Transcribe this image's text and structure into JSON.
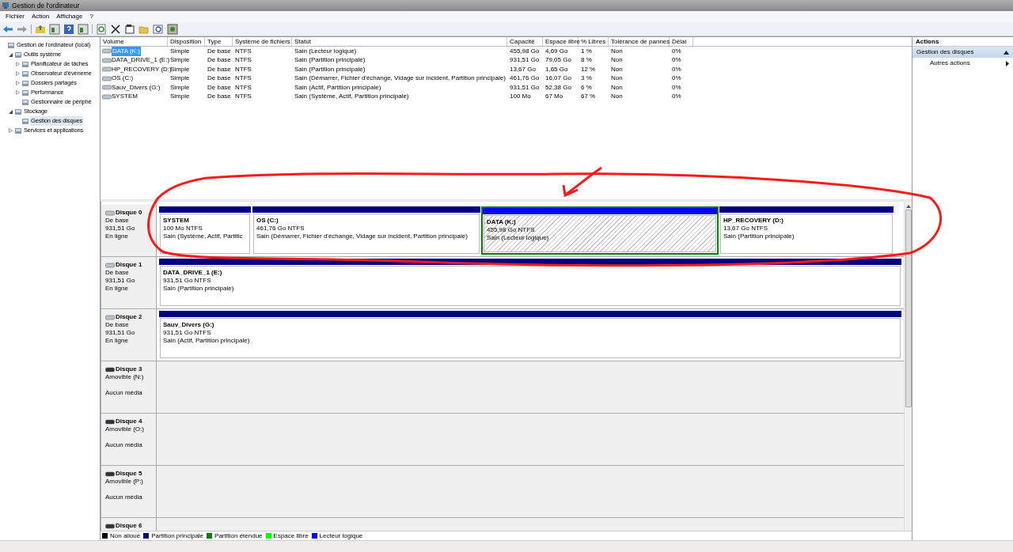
{
  "window": {
    "title": "Gestion de l'ordinateur"
  },
  "menu": [
    "Fichier",
    "Action",
    "Affichage",
    "?"
  ],
  "tree": [
    {
      "label": "Gestion de l'ordinateur (local)",
      "selected": false,
      "children": [
        {
          "label": "Outils système",
          "expanded": true,
          "selected": false,
          "children": [
            {
              "label": "Planificateur de tâches",
              "expanded": false,
              "selected": false
            },
            {
              "label": "Observateur d'événeme",
              "expanded": false,
              "selected": false
            },
            {
              "label": "Dossiers partagés",
              "expanded": false,
              "selected": false
            },
            {
              "label": "Performance",
              "expanded": false,
              "selected": false
            },
            {
              "label": "Gestionnaire de périphé",
              "selected": false
            }
          ]
        },
        {
          "label": "Stockage",
          "expanded": true,
          "selected": false,
          "children": [
            {
              "label": "Gestion des disques",
              "selected": true
            }
          ]
        },
        {
          "label": "Services et applications",
          "expanded": false,
          "selected": false
        }
      ]
    }
  ],
  "volumes": {
    "columns": [
      "Volume",
      "Disposition",
      "Type",
      "Système de fichiers",
      "Statut",
      "Capacité",
      "Espace libre",
      "% Libres",
      "Tolérance de pannes",
      "Délai"
    ],
    "rows": [
      {
        "selected": true,
        "cells": [
          "DATA (K:)",
          "Simple",
          "De base",
          "NTFS",
          "Sain (Lecteur logique)",
          "455,98 Go",
          "4,69 Go",
          "1 %",
          "Non",
          "0%"
        ]
      },
      {
        "selected": false,
        "cells": [
          "DATA_DRIVE_1 (E:)",
          "Simple",
          "De base",
          "NTFS",
          "Sain (Partition principale)",
          "931,51 Go",
          "79,05 Go",
          "8 %",
          "Non",
          "0%"
        ]
      },
      {
        "selected": false,
        "cells": [
          "HP_RECOVERY (D:)",
          "Simple",
          "De base",
          "NTFS",
          "Sain (Partition principale)",
          "13,67 Go",
          "1,65 Go",
          "12 %",
          "Non",
          "0%"
        ]
      },
      {
        "selected": false,
        "cells": [
          "OS (C:)",
          "Simple",
          "De base",
          "NTFS",
          "Sain (Démarrer, Fichier d'échange, Vidage sur incident, Partition principale)",
          "461,76 Go",
          "16,07 Go",
          "3 %",
          "Non",
          "0%"
        ]
      },
      {
        "selected": false,
        "cells": [
          "Sauv_Divers (G:)",
          "Simple",
          "De base",
          "NTFS",
          "Sain (Actif, Partition principale)",
          "931,51 Go",
          "52,38 Go",
          "6 %",
          "Non",
          "0%"
        ]
      },
      {
        "selected": false,
        "cells": [
          "SYSTEM",
          "Simple",
          "De base",
          "NTFS",
          "Sain (Système, Actif, Partition principale)",
          "100 Mo",
          "67 Mo",
          "67 %",
          "Non",
          "0%"
        ]
      }
    ]
  },
  "disks": [
    {
      "kind": "basic",
      "name": "Disque 0",
      "lines": [
        "De base",
        "931,51 Go",
        "En ligne"
      ],
      "partitions": [
        {
          "kind": "primary",
          "selected": false,
          "name": "SYSTEM",
          "size": "100 Mo NTFS",
          "status": "Sain (Système, Actif, Partitic"
        },
        {
          "kind": "primary",
          "selected": false,
          "name": "OS  (C:)",
          "size": "461,76 Go NTFS",
          "status": "Sain (Démarrer, Fichier d'échange, Vidage sur incident, Partition principale)"
        },
        {
          "kind": "logical",
          "selected": true,
          "name": "DATA  (K:)",
          "size": "455,98 Go NTFS",
          "status": "Sain (Lecteur logique)"
        },
        {
          "kind": "primary",
          "selected": false,
          "name": "HP_RECOVERY  (D:)",
          "size": "13,67 Go NTFS",
          "status": "Sain (Partition principale)"
        }
      ]
    },
    {
      "kind": "basic",
      "name": "Disque 1",
      "lines": [
        "De base",
        "931,51 Go",
        "En ligne"
      ],
      "partitions": [
        {
          "kind": "primary",
          "selected": false,
          "name": "DATA_DRIVE_1  (E:)",
          "size": "931,51 Go NTFS",
          "status": "Sain (Partition principale)"
        }
      ]
    },
    {
      "kind": "basic",
      "name": "Disque 2",
      "lines": [
        "De base",
        "931,51 Go",
        "En ligne"
      ],
      "partitions": [
        {
          "kind": "primary",
          "selected": false,
          "name": "Sauv_Divers  (G:)",
          "size": "931,51 Go NTFS",
          "status": "Sain (Actif, Partition principale)"
        }
      ]
    },
    {
      "kind": "removable",
      "name": "Disque 3",
      "lines": [
        "Amovible (N:)",
        "Aucun média"
      ]
    },
    {
      "kind": "removable",
      "name": "Disque 4",
      "lines": [
        "Amovible (O:)",
        "Aucun média"
      ]
    },
    {
      "kind": "removable",
      "name": "Disque 5",
      "lines": [
        "Amovible (P:)",
        "Aucun média"
      ]
    },
    {
      "kind": "removable",
      "name": "Disque 6"
    }
  ],
  "legend": [
    {
      "label": "Non alloué",
      "color": "#000000"
    },
    {
      "label": "Partition principale",
      "color": "#000080"
    },
    {
      "label": "Partition étendue",
      "color": "#008000"
    },
    {
      "label": "Espace libre",
      "color": "#00ff00"
    },
    {
      "label": "Lecteur logique",
      "color": "#0000ff"
    }
  ],
  "actions": {
    "title": "Actions",
    "section": {
      "label": "Gestion des disques",
      "expanded": true
    },
    "items": [
      "Autres actions"
    ]
  }
}
